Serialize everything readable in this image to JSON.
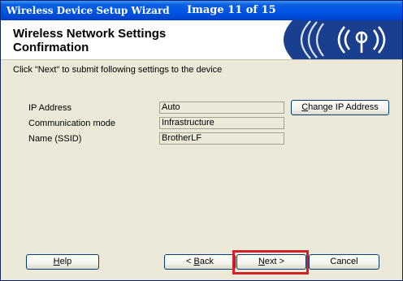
{
  "window": {
    "title": "Wireless Device Setup Wizard",
    "step_label": "Image 11 of 15"
  },
  "header": {
    "heading_line1": "Wireless Network Settings",
    "heading_line2": "Confirmation",
    "banner_icon": "wireless-signal-icon"
  },
  "instruction": "Click \"Next\" to submit following settings to the device",
  "settings": [
    {
      "label": "IP Address",
      "value": "Auto"
    },
    {
      "label": "Communication mode",
      "value": "Infrastructure"
    },
    {
      "label": "Name (SSID)",
      "value": "BrotherLF"
    }
  ],
  "buttons": {
    "change_ip_mnemonic": "C",
    "change_ip_rest": "hange IP Address",
    "help_mnemonic": "H",
    "help_rest": "elp",
    "back_prefix": "< ",
    "back_mnemonic": "B",
    "back_rest": "ack",
    "next_mnemonic": "N",
    "next_rest": "ext >",
    "cancel": "Cancel"
  },
  "colors": {
    "titlebar": "#0055e5",
    "dialog_bg": "#ece9d8",
    "banner": "#1b3f8f",
    "highlight": "#d42027"
  }
}
